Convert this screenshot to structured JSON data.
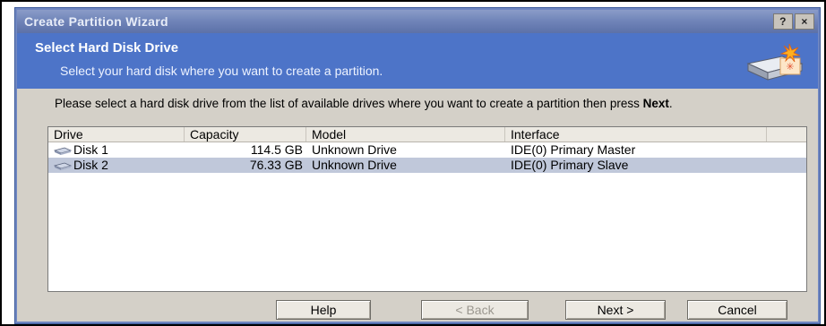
{
  "window": {
    "title": "Create Partition Wizard",
    "help_button": "?",
    "close_button": "×"
  },
  "header": {
    "title": "Select Hard Disk Drive",
    "subtitle": "Select your hard disk where you want to create a partition.",
    "icon": "hard-disk-new-icon"
  },
  "instructions": {
    "text_before": "Please select a hard disk drive from the list of available drives where you want to create a partition then press ",
    "emphasis": "Next",
    "text_after": "."
  },
  "drive_list": {
    "columns": [
      "Drive",
      "Capacity",
      "Model",
      "Interface"
    ],
    "rows": [
      {
        "drive": "Disk 1",
        "capacity": "114.5 GB",
        "model": "Unknown Drive",
        "interface": "IDE(0) Primary Master",
        "selected": false
      },
      {
        "drive": "Disk 2",
        "capacity": "76.33 GB",
        "model": "Unknown Drive",
        "interface": "IDE(0) Primary Slave",
        "selected": true
      }
    ]
  },
  "buttons": {
    "help": "Help",
    "back": "< Back",
    "next": "Next >",
    "cancel": "Cancel"
  },
  "colors": {
    "header_bg": "#4d74c8",
    "selection_bg": "#c0c8da",
    "dialog_bg": "#d4d0c8"
  }
}
